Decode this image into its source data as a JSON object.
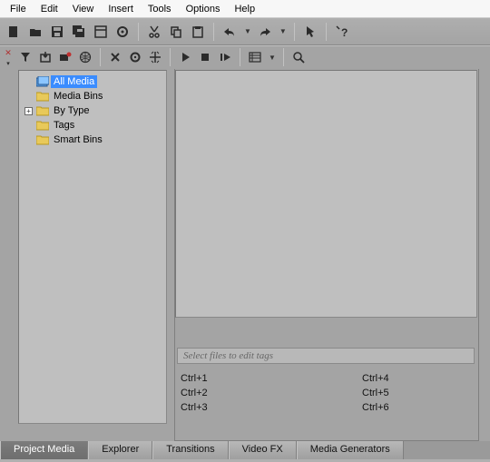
{
  "menu": {
    "items": [
      "File",
      "Edit",
      "View",
      "Insert",
      "Tools",
      "Options",
      "Help"
    ]
  },
  "toolbar1_icons": [
    "new-icon",
    "open-icon",
    "save-icon",
    "save-all-icon",
    "properties-icon",
    "gear-icon",
    "cut-icon",
    "copy-icon",
    "paste-icon",
    "undo-icon",
    "redo-icon",
    "cursor-icon",
    "help-icon"
  ],
  "toolbar2_icons": [
    "close-icon",
    "filter-icon",
    "import-icon",
    "record-icon",
    "web-icon",
    "delete-icon",
    "gear2-icon",
    "crosshair-icon",
    "play-icon",
    "stop-icon",
    "play-from-icon",
    "views-icon",
    "search-icon"
  ],
  "tree": {
    "items": [
      {
        "label": "All Media",
        "icon": "allmedia-icon",
        "selected": true,
        "expandable": false
      },
      {
        "label": "Media Bins",
        "icon": "folder-icon",
        "selected": false,
        "expandable": false
      },
      {
        "label": "By Type",
        "icon": "folder-icon",
        "selected": false,
        "expandable": true
      },
      {
        "label": "Tags",
        "icon": "folder-icon",
        "selected": false,
        "expandable": false
      },
      {
        "label": "Smart Bins",
        "icon": "folder-icon",
        "selected": false,
        "expandable": false
      }
    ]
  },
  "tag_prompt": "Select files to edit tags",
  "shortcuts": {
    "col1": [
      "Ctrl+1",
      "Ctrl+2",
      "Ctrl+3"
    ],
    "col2": [
      "Ctrl+4",
      "Ctrl+5",
      "Ctrl+6"
    ]
  },
  "tabs": [
    {
      "label": "Project Media",
      "active": true
    },
    {
      "label": "Explorer",
      "active": false
    },
    {
      "label": "Transitions",
      "active": false
    },
    {
      "label": "Video FX",
      "active": false
    },
    {
      "label": "Media Generators",
      "active": false
    }
  ]
}
